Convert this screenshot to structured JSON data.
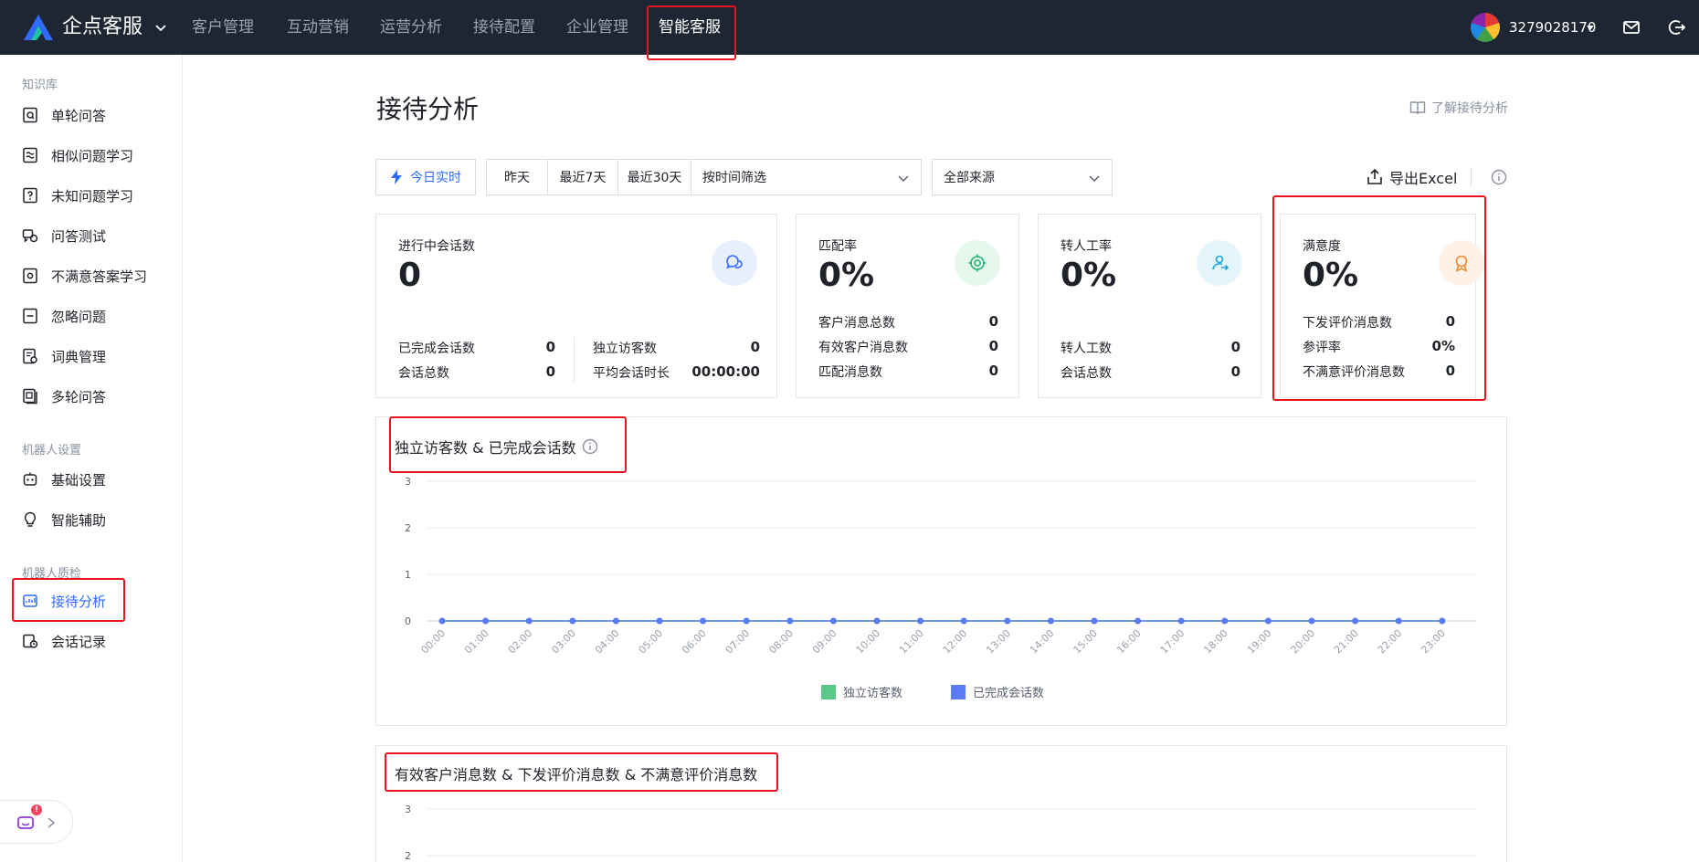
{
  "app": {
    "brand": "企点客服",
    "nav": [
      "客户管理",
      "互动营销",
      "运营分析",
      "接待配置",
      "企业管理",
      "智能客服"
    ],
    "active_nav": "智能客服",
    "user_id": "3279028170"
  },
  "sidebar": {
    "groups": [
      {
        "title": "知识库",
        "items": [
          "单轮问答",
          "相似问题学习",
          "未知问题学习",
          "问答测试",
          "不满意答案学习",
          "忽略问题",
          "词典管理",
          "多轮问答"
        ]
      },
      {
        "title": "机器人设置",
        "items": [
          "基础设置",
          "智能辅助"
        ]
      },
      {
        "title": "机器人质检",
        "items": [
          "接待分析",
          "会话记录"
        ]
      }
    ],
    "active_item": "接待分析",
    "notification_badge": "!"
  },
  "page": {
    "title": "接待分析",
    "learn_link": "了解接待分析"
  },
  "filters": {
    "today": "今日实时",
    "ranges": [
      "昨天",
      "最近7天",
      "最近30天"
    ],
    "time_filter": "按时间筛选",
    "source": "全部来源",
    "export": "导出Excel"
  },
  "cards": {
    "sessions": {
      "label": "进行中会话数",
      "value": "0",
      "rows_left": [
        {
          "label": "已完成会话数",
          "value": "0"
        },
        {
          "label": "会话总数",
          "value": "0"
        }
      ],
      "rows_right": [
        {
          "label": "独立访客数",
          "value": "0"
        },
        {
          "label": "平均会话时长",
          "value": "00:00:00"
        }
      ]
    },
    "match": {
      "label": "匹配率",
      "value": "0%",
      "rows": [
        {
          "label": "客户消息总数",
          "value": "0"
        },
        {
          "label": "有效客户消息数",
          "value": "0"
        },
        {
          "label": "匹配消息数",
          "value": "0"
        }
      ]
    },
    "transfer": {
      "label": "转人工率",
      "value": "0%",
      "rows": [
        {
          "label": "转人工数",
          "value": "0"
        },
        {
          "label": "会话总数",
          "value": "0"
        }
      ]
    },
    "satisfaction": {
      "label": "满意度",
      "value": "0%",
      "rows": [
        {
          "label": "下发评价消息数",
          "value": "0"
        },
        {
          "label": "参评率",
          "value": "0%"
        },
        {
          "label": "不满意评价消息数",
          "value": "0"
        }
      ]
    }
  },
  "colors": {
    "accent": "#2f6bff",
    "series_green": "#5cc98a",
    "series_blue": "#5b7cf5",
    "highlight": "#e5141f",
    "topbar": "#1f2633"
  },
  "chart_data": [
    {
      "type": "line",
      "title": "独立访客数 & 已完成会话数",
      "x": [
        "00:00",
        "01:00",
        "02:00",
        "03:00",
        "04:00",
        "05:00",
        "06:00",
        "07:00",
        "08:00",
        "09:00",
        "10:00",
        "11:00",
        "12:00",
        "13:00",
        "14:00",
        "15:00",
        "16:00",
        "17:00",
        "18:00",
        "19:00",
        "20:00",
        "21:00",
        "22:00",
        "23:00"
      ],
      "series": [
        {
          "name": "独立访客数",
          "values": [
            0,
            0,
            0,
            0,
            0,
            0,
            0,
            0,
            0,
            0,
            0,
            0,
            0,
            0,
            0,
            0,
            0,
            0,
            0,
            0,
            0,
            0,
            0,
            0
          ]
        },
        {
          "name": "已完成会话数",
          "values": [
            0,
            0,
            0,
            0,
            0,
            0,
            0,
            0,
            0,
            0,
            0,
            0,
            0,
            0,
            0,
            0,
            0,
            0,
            0,
            0,
            0,
            0,
            0,
            0
          ]
        }
      ],
      "ylim": [
        0,
        3
      ],
      "yticks": [
        0,
        1,
        2,
        3
      ],
      "grid": true,
      "legend": "bottom-center"
    },
    {
      "type": "line",
      "title": "有效客户消息数 & 下发评价消息数 & 不满意评价消息数",
      "ylim": [
        0,
        3
      ],
      "yticks": [
        2,
        3
      ],
      "grid": true
    }
  ]
}
